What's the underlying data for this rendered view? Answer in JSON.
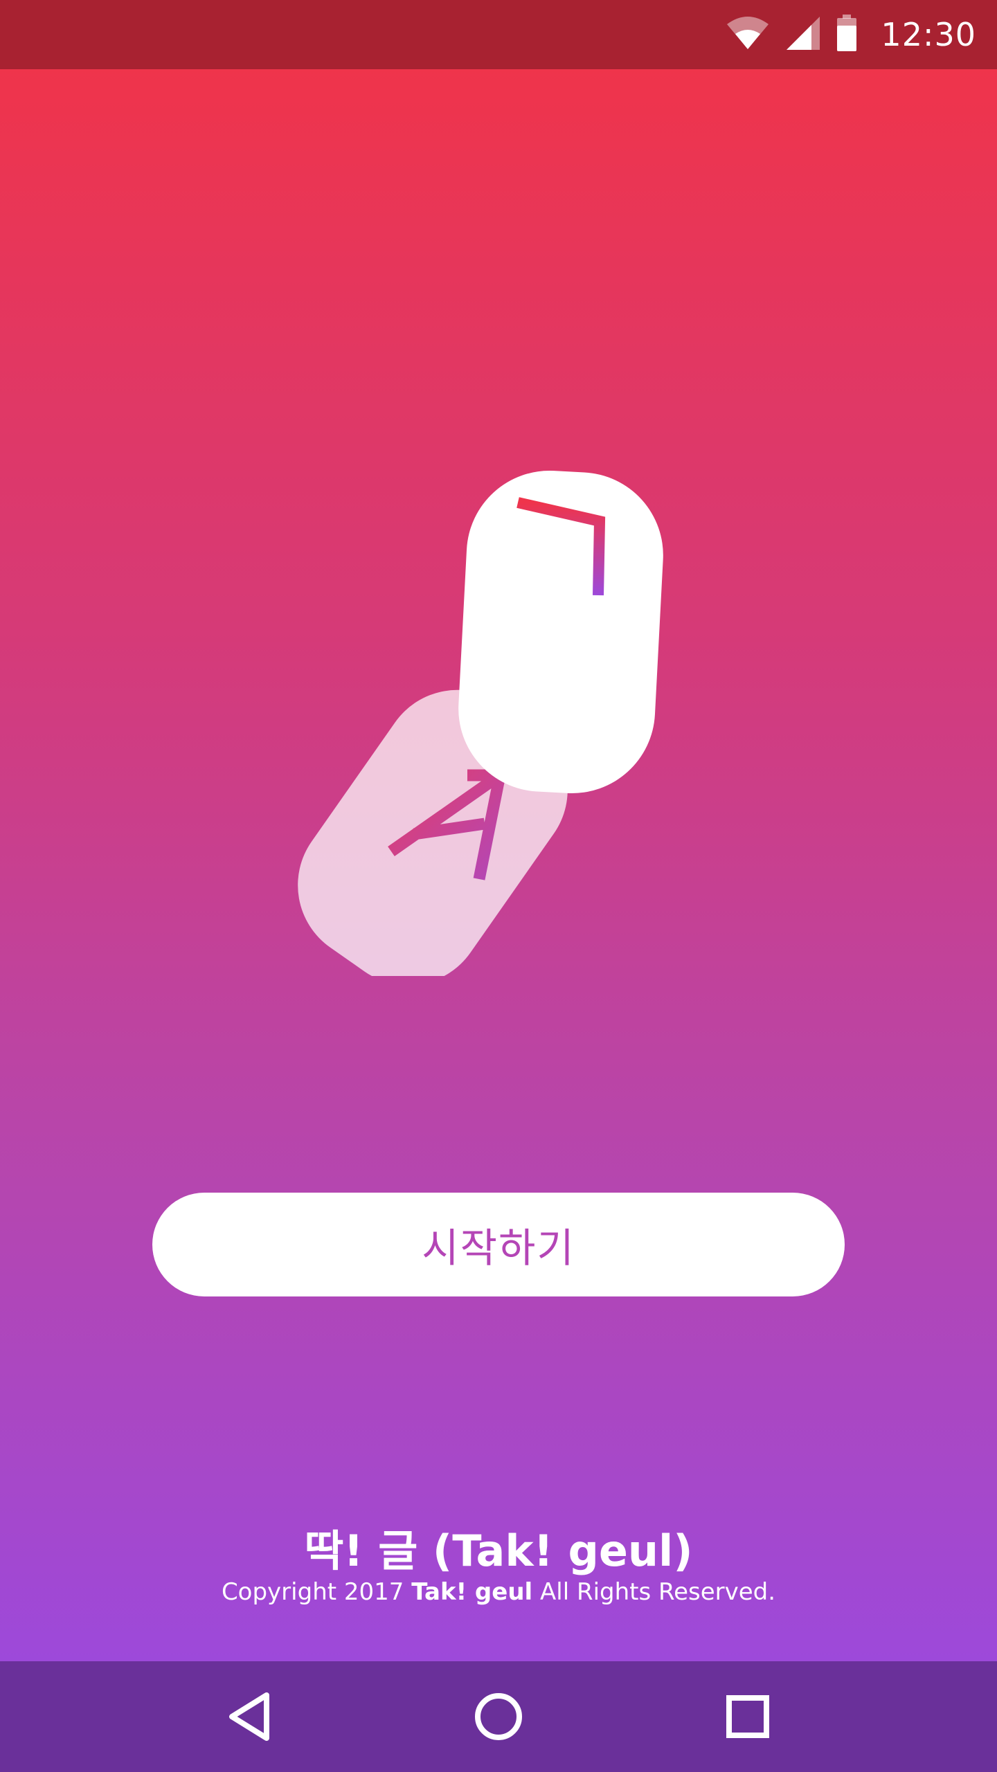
{
  "status_bar": {
    "time": "12:30",
    "icons": [
      "wifi-icon",
      "cellular-signal-icon",
      "battery-icon"
    ]
  },
  "logo": {
    "front_glyph": "ㄱ",
    "back_glyph": "A"
  },
  "start_button": {
    "label": "시작하기"
  },
  "footer": {
    "app_title": "딱! 글 (Tak! geul)",
    "copyright_prefix": "Copyright 2017 ",
    "copyright_brand": "Tak! geul",
    "copyright_suffix": " All Rights Reserved."
  },
  "nav_bar": {
    "buttons": [
      "back-icon",
      "home-icon",
      "recents-icon"
    ]
  },
  "colors": {
    "status_bar": "#a82231",
    "gradient_top": "#ef344b",
    "gradient_bottom": "#9d49da",
    "nav_bar": "#6a309a",
    "button_text": "#b445b6"
  }
}
